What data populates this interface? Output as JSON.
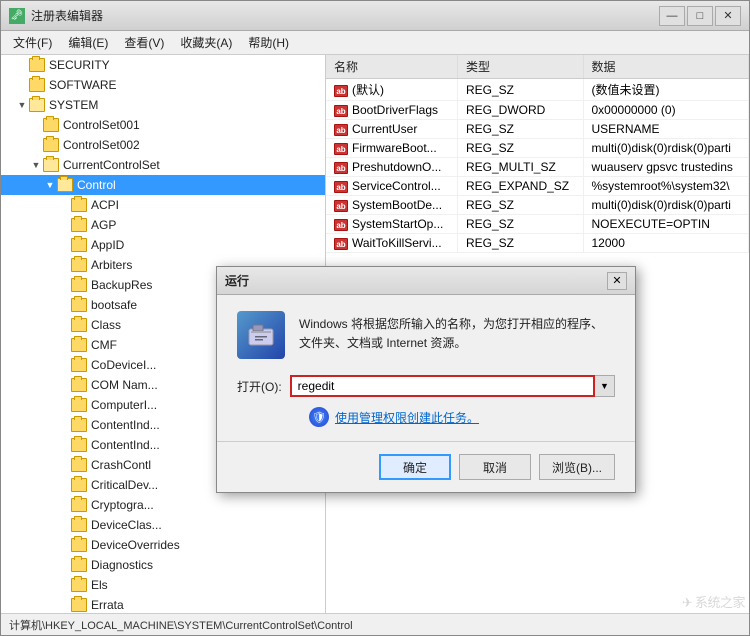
{
  "window": {
    "title": "注册表编辑器",
    "titlebar_icon": "🗝",
    "close_btn": "✕",
    "maximize_btn": "□",
    "minimize_btn": "—"
  },
  "menu": {
    "items": [
      "文件(F)",
      "编辑(E)",
      "查看(V)",
      "收藏夹(A)",
      "帮助(H)"
    ]
  },
  "tree": {
    "items": [
      {
        "id": "security",
        "label": "SECURITY",
        "indent": 1,
        "arrow": "",
        "expanded": false
      },
      {
        "id": "software",
        "label": "SOFTWARE",
        "indent": 1,
        "arrow": "",
        "expanded": false
      },
      {
        "id": "system",
        "label": "SYSTEM",
        "indent": 1,
        "arrow": "▼",
        "expanded": true
      },
      {
        "id": "controlset001",
        "label": "ControlSet001",
        "indent": 2,
        "arrow": "",
        "expanded": false
      },
      {
        "id": "controlset002",
        "label": "ControlSet002",
        "indent": 2,
        "arrow": "",
        "expanded": false
      },
      {
        "id": "currentcontrolset",
        "label": "CurrentControlSet",
        "indent": 2,
        "arrow": "▼",
        "expanded": true
      },
      {
        "id": "control",
        "label": "Control",
        "indent": 3,
        "arrow": "▼",
        "expanded": true,
        "selected": true
      },
      {
        "id": "acpi",
        "label": "ACPI",
        "indent": 4,
        "arrow": "",
        "expanded": false
      },
      {
        "id": "agp",
        "label": "AGP",
        "indent": 4,
        "arrow": "",
        "expanded": false
      },
      {
        "id": "appid",
        "label": "AppID",
        "indent": 4,
        "arrow": "",
        "expanded": false
      },
      {
        "id": "arbiters",
        "label": "Arbiters",
        "indent": 4,
        "arrow": "",
        "expanded": false
      },
      {
        "id": "backupres",
        "label": "BackupRes",
        "indent": 4,
        "arrow": "",
        "expanded": false
      },
      {
        "id": "bootsafe",
        "label": "bootsafe",
        "indent": 4,
        "arrow": "",
        "expanded": false
      },
      {
        "id": "class",
        "label": "Class",
        "indent": 4,
        "arrow": "",
        "expanded": false
      },
      {
        "id": "cmf",
        "label": "CMF",
        "indent": 4,
        "arrow": "",
        "expanded": false
      },
      {
        "id": "codevicei",
        "label": "CoDeviceI...",
        "indent": 4,
        "arrow": "",
        "expanded": false
      },
      {
        "id": "comnam",
        "label": "COM Nam...",
        "indent": 4,
        "arrow": "",
        "expanded": false
      },
      {
        "id": "computeri",
        "label": "ComputerI...",
        "indent": 4,
        "arrow": "",
        "expanded": false
      },
      {
        "id": "contentind",
        "label": "ContentInd...",
        "indent": 4,
        "arrow": "",
        "expanded": false
      },
      {
        "id": "contentind2",
        "label": "ContentInd...",
        "indent": 4,
        "arrow": "",
        "expanded": false
      },
      {
        "id": "crashcontl",
        "label": "CrashContl",
        "indent": 4,
        "arrow": "",
        "expanded": false
      },
      {
        "id": "criticaldev",
        "label": "CriticalDev...",
        "indent": 4,
        "arrow": "",
        "expanded": false
      },
      {
        "id": "cryptogra",
        "label": "Cryptogra...",
        "indent": 4,
        "arrow": "",
        "expanded": false
      },
      {
        "id": "deviceclas",
        "label": "DeviceClas...",
        "indent": 4,
        "arrow": "",
        "expanded": false
      },
      {
        "id": "deviceoverrides",
        "label": "DeviceOverrides",
        "indent": 4,
        "arrow": "",
        "expanded": false
      },
      {
        "id": "diagnostics",
        "label": "Diagnostics",
        "indent": 4,
        "arrow": "",
        "expanded": false
      },
      {
        "id": "els",
        "label": "Els",
        "indent": 4,
        "arrow": "",
        "expanded": false
      },
      {
        "id": "errata",
        "label": "Errata",
        "indent": 4,
        "arrow": "",
        "expanded": false
      }
    ]
  },
  "table": {
    "headers": [
      "名称",
      "类型",
      "数据"
    ],
    "rows": [
      {
        "name": "(默认)",
        "type": "REG_SZ",
        "data": "(数值未设置)",
        "icon": "ab"
      },
      {
        "name": "BootDriverFlags",
        "type": "REG_DWORD",
        "data": "0x00000000 (0)",
        "icon": "ab"
      },
      {
        "name": "CurrentUser",
        "type": "REG_SZ",
        "data": "USERNAME",
        "icon": "ab"
      },
      {
        "name": "FirmwareBoot...",
        "type": "REG_SZ",
        "data": "multi(0)disk(0)rdisk(0)parti",
        "icon": "ab"
      },
      {
        "name": "PreshutdownO...",
        "type": "REG_MULTI_SZ",
        "data": "wuauserv gpsvc trustedins",
        "icon": "ab"
      },
      {
        "name": "ServiceControl...",
        "type": "REG_EXPAND_SZ",
        "data": "%systemroot%\\system32\\",
        "icon": "ab"
      },
      {
        "name": "SystemBootDe...",
        "type": "REG_SZ",
        "data": "multi(0)disk(0)rdisk(0)parti",
        "icon": "ab"
      },
      {
        "name": "SystemStartOp...",
        "type": "REG_SZ",
        "data": "NOEXECUTE=OPTIN",
        "icon": "ab"
      },
      {
        "name": "WaitToKillServi...",
        "type": "REG_SZ",
        "data": "12000",
        "icon": "ab"
      }
    ]
  },
  "status": {
    "text": "计算机\\HKEY_LOCAL_MACHINE\\SYSTEM\\CurrentControlSet\\Control"
  },
  "run_dialog": {
    "title": "运行",
    "close_btn": "✕",
    "description": "Windows 将根据您所输入的名称，为您打开相应的程序、\n文件夹、文档或 Internet 资源。",
    "open_label": "打开(O):",
    "input_value": "regedit",
    "admin_link": "使用管理权限创建此任务。",
    "ok_btn": "确定",
    "cancel_btn": "取消",
    "browse_btn": "浏览(B)..."
  },
  "watermark": "系统之家"
}
